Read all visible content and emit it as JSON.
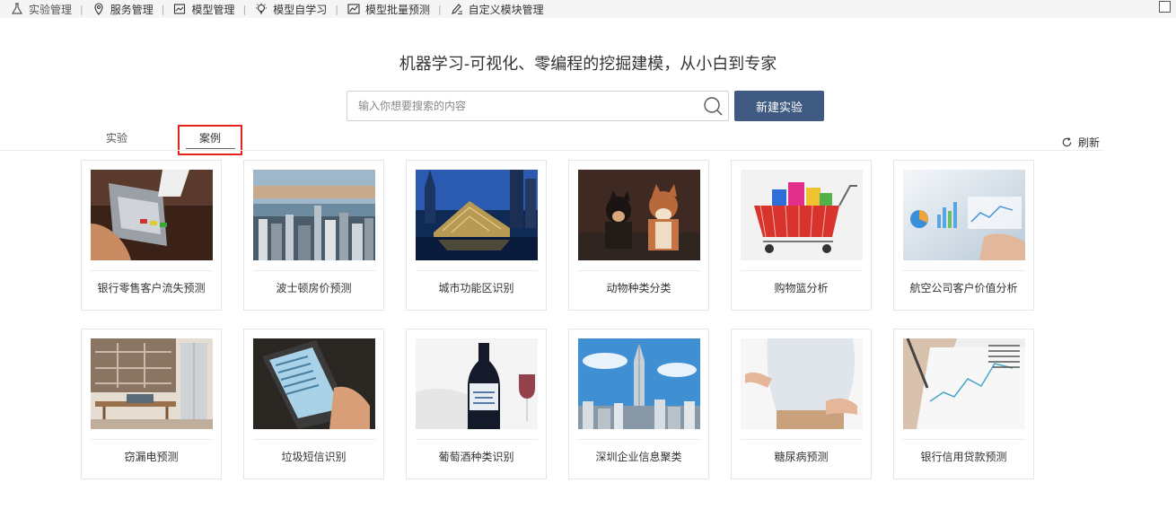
{
  "toolbar": {
    "items": [
      {
        "label": "实验管理",
        "icon": "flask-icon"
      },
      {
        "label": "服务管理",
        "icon": "location-pin-icon"
      },
      {
        "label": "模型管理",
        "icon": "model-chart-icon"
      },
      {
        "label": "模型自学习",
        "icon": "lightbulb-icon"
      },
      {
        "label": "模型批量预测",
        "icon": "line-chart-icon"
      },
      {
        "label": "自定义模块管理",
        "icon": "pen-edit-icon"
      }
    ],
    "separator": "|"
  },
  "header": {
    "slogan": "机器学习-可视化、零编程的挖掘建模，从小白到专家"
  },
  "search": {
    "placeholder": "输入你想要搜索的内容",
    "value": ""
  },
  "new_experiment_label": "新建实验",
  "tabs": {
    "experiment": "实验",
    "cases": "案例",
    "active": "案例"
  },
  "refresh_label": "刷新",
  "cases": [
    {
      "title": "银行零售客户流失预测",
      "icon": "card-payment-terminal-photo"
    },
    {
      "title": "波士顿房价预测",
      "icon": "city-skyline-photo"
    },
    {
      "title": "城市功能区识别",
      "icon": "night-architecture-photo"
    },
    {
      "title": "动物种类分类",
      "icon": "shiba-dogs-photo"
    },
    {
      "title": "购物篮分析",
      "icon": "shopping-cart-photo"
    },
    {
      "title": "航空公司客户价值分析",
      "icon": "data-charts-photo"
    },
    {
      "title": "窃漏电预测",
      "icon": "kitchen-interior-photo"
    },
    {
      "title": "垃圾短信识别",
      "icon": "phone-sms-photo"
    },
    {
      "title": "葡萄酒种类识别",
      "icon": "wine-bottle-photo"
    },
    {
      "title": "深圳企业信息聚类",
      "icon": "shenzhen-skyscraper-photo"
    },
    {
      "title": "糖尿病预测",
      "icon": "person-belly-photo"
    },
    {
      "title": "银行信用贷款预测",
      "icon": "financial-newspaper-photo"
    }
  ],
  "colors": {
    "primary_button": "#3f5a80",
    "highlight_box": "#e1251b",
    "toolbar_bg": "#f5f5f5"
  }
}
